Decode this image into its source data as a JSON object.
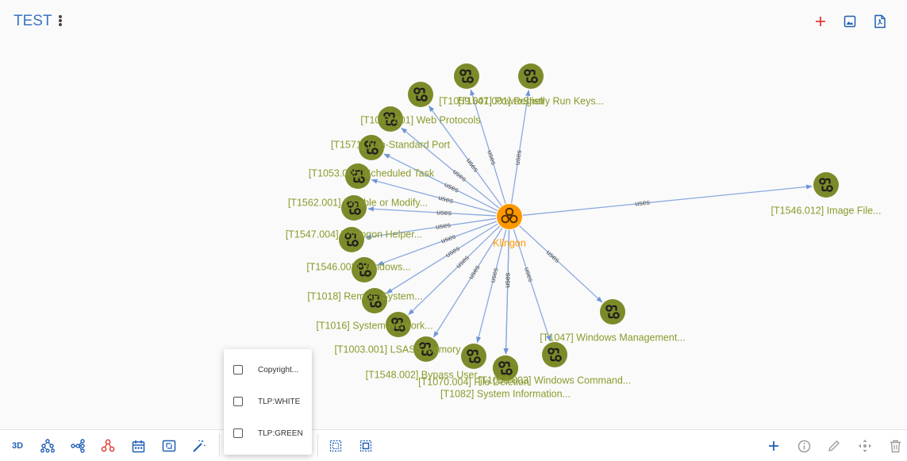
{
  "header": {
    "title": "TEST",
    "actions": [
      {
        "name": "add",
        "icon": "plus-icon",
        "color": "#e53935"
      },
      {
        "name": "export-image",
        "icon": "image-icon",
        "color": "#1f5fb3"
      },
      {
        "name": "export-pdf",
        "icon": "pdf-file-icon",
        "color": "#1f5fb3"
      }
    ]
  },
  "graph": {
    "colors": {
      "node": "#7d8a2a",
      "center": "#ff9800",
      "label": "#8a9a2c",
      "edge": "#8aa9df",
      "edge_label": "#555555"
    },
    "center": {
      "label": "Klingon",
      "icon": "biohazard-icon"
    },
    "edge_label": "uses",
    "nodes": [
      {
        "label": "[T1059.001] PowerShell",
        "icon": "attack-pattern-icon"
      },
      {
        "label": "[T1547.001] Registry Run Keys...",
        "icon": "attack-pattern-icon"
      },
      {
        "label": "[T1071.001] Web Protocols",
        "icon": "attack-pattern-icon"
      },
      {
        "label": "[T1571] Non-Standard Port",
        "icon": "attack-pattern-icon"
      },
      {
        "label": "[T1053.005] Scheduled Task",
        "icon": "attack-pattern-icon"
      },
      {
        "label": "[T1562.001] Disable or Modify...",
        "icon": "attack-pattern-icon"
      },
      {
        "label": "[T1547.004] Winlogon Helper...",
        "icon": "attack-pattern-icon"
      },
      {
        "label": "[T1546.003] Windows...",
        "icon": "attack-pattern-icon"
      },
      {
        "label": "[T1018] Remote System...",
        "icon": "attack-pattern-icon"
      },
      {
        "label": "[T1016] System Network...",
        "icon": "attack-pattern-icon"
      },
      {
        "label": "[T1003.001] LSASS Memory",
        "icon": "attack-pattern-icon"
      },
      {
        "label": "[T1548.002] Bypass User...",
        "icon": "attack-pattern-icon"
      },
      {
        "label": "[T1070.004] File Deletion",
        "icon": "attack-pattern-icon"
      },
      {
        "label": "[T1082] System Information...",
        "icon": "attack-pattern-icon"
      },
      {
        "label": "[T1059.003] Windows Command...",
        "icon": "attack-pattern-icon"
      },
      {
        "label": "[T1047] Windows Management...",
        "icon": "attack-pattern-icon"
      },
      {
        "label": "[T1546.012] Image File...",
        "icon": "attack-pattern-icon"
      }
    ]
  },
  "toolbar": {
    "mode_3d_label": "3D",
    "left_tools": [
      {
        "name": "tree-layout",
        "icon": "tree-layout-icon"
      },
      {
        "name": "force-layout",
        "icon": "force-layout-icon"
      },
      {
        "name": "relations-layout",
        "icon": "relations-layout-icon"
      },
      {
        "name": "timeline",
        "icon": "calendar-icon"
      },
      {
        "name": "screenshot",
        "icon": "aspect-ratio-icon"
      },
      {
        "name": "auto-fix",
        "icon": "magic-wand-icon"
      }
    ],
    "selection_tools": [
      {
        "name": "select-all",
        "icon": "select-all-icon"
      },
      {
        "name": "select-group",
        "icon": "select-group-icon"
      }
    ],
    "right_tools": [
      {
        "name": "add-entity",
        "icon": "plus-icon"
      },
      {
        "name": "info",
        "icon": "info-icon"
      },
      {
        "name": "edit",
        "icon": "pencil-icon"
      },
      {
        "name": "move",
        "icon": "move-icon"
      },
      {
        "name": "delete",
        "icon": "trash-icon"
      }
    ]
  },
  "marking_filter": {
    "options": [
      {
        "label": "Copyright...",
        "checked": false
      },
      {
        "label": "TLP:WHITE",
        "checked": false
      },
      {
        "label": "TLP:GREEN",
        "checked": false
      }
    ]
  }
}
